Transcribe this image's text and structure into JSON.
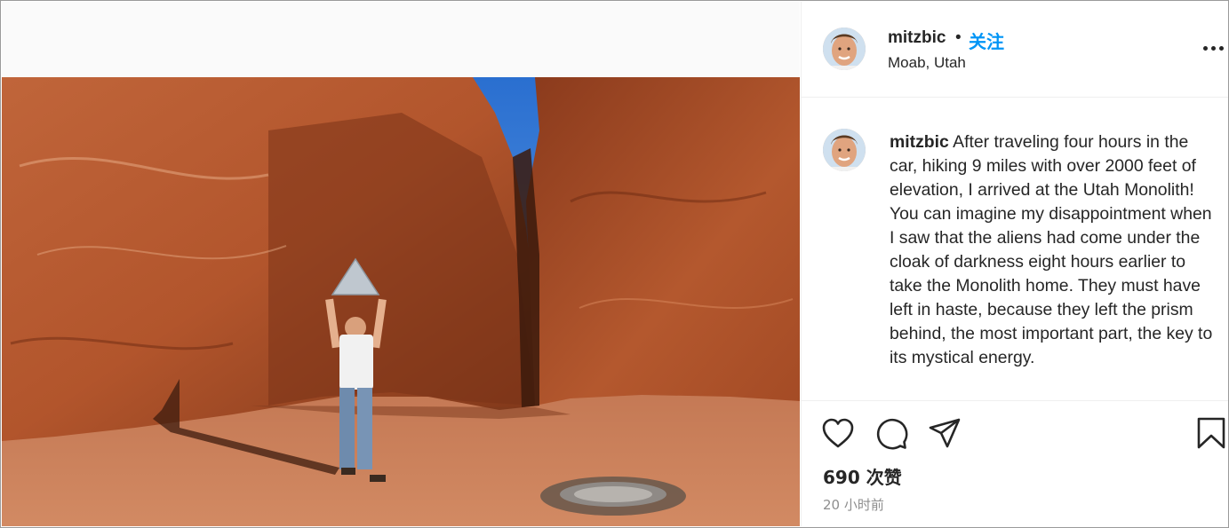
{
  "post": {
    "media": {
      "description_icon": "photo-image"
    },
    "header": {
      "username": "mitzbic",
      "separator": "•",
      "follow_label": "关注",
      "location": "Moab, Utah",
      "more_icon": "more-horizontal-icon"
    },
    "caption": {
      "username": "mitzbic",
      "text": "After traveling four hours in the car, hiking 9 miles with over 2000 feet of elevation, I arrived at the Utah Monolith! You can imagine my disappointment when I saw that the aliens had come under the cloak of darkness eight hours earlier to take the Monolith home. They must have left in haste, because they left the prism behind, the most important part, the key to its mystical energy."
    },
    "actions": {
      "like_icon": "heart-icon",
      "comment_icon": "comment-icon",
      "share_icon": "share-icon",
      "save_icon": "bookmark-icon"
    },
    "likes_text": "690 次赞",
    "time_text": "20 小时前"
  },
  "colors": {
    "accent": "#0095f6",
    "text": "#262626",
    "muted": "#8e8e8e",
    "border": "#efefef"
  }
}
